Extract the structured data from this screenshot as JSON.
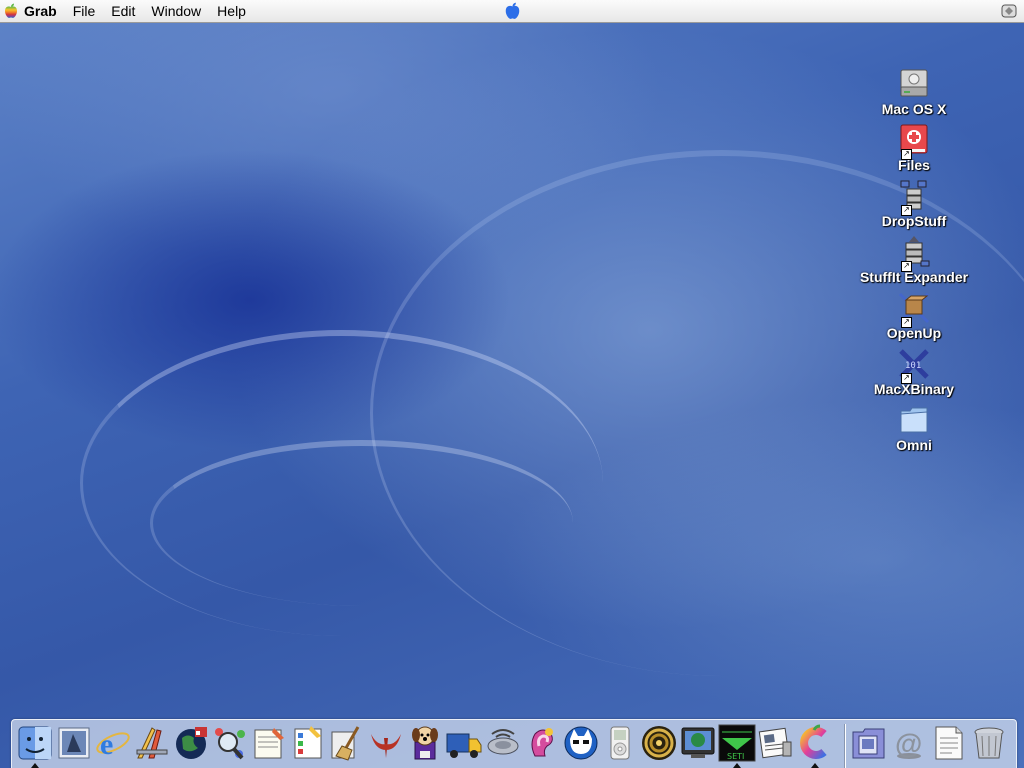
{
  "menubar": {
    "app_name": "Grab",
    "items": [
      "File",
      "Edit",
      "Window",
      "Help"
    ]
  },
  "desktop": {
    "icons": [
      {
        "label": "Mac OS X",
        "icon": "hard-drive-icon",
        "alias": false
      },
      {
        "label": "Files",
        "icon": "files-folder-icon",
        "alias": true
      },
      {
        "label": "DropStuff",
        "icon": "dropstuff-icon",
        "alias": true
      },
      {
        "label": "StuffIt Expander",
        "icon": "stuffit-expander-icon",
        "alias": true
      },
      {
        "label": "OpenUp",
        "icon": "openup-icon",
        "alias": true
      },
      {
        "label": "MacXBinary",
        "icon": "macxbinary-icon",
        "alias": true
      },
      {
        "label": "Omni",
        "icon": "folder-icon",
        "alias": false
      }
    ]
  },
  "dock": {
    "apps": [
      {
        "icon": "finder-icon",
        "running": true
      },
      {
        "icon": "mail-icon",
        "running": false
      },
      {
        "icon": "internet-explorer-icon",
        "running": false
      },
      {
        "icon": "pencil-ruler-icon",
        "running": false
      },
      {
        "icon": "globe-icon",
        "running": false
      },
      {
        "icon": "magnifier-molecule-icon",
        "running": false
      },
      {
        "icon": "notepad-icon",
        "running": false
      },
      {
        "icon": "checklist-icon",
        "running": false
      },
      {
        "icon": "broom-icon",
        "running": false
      },
      {
        "icon": "quake-icon",
        "running": false
      },
      {
        "icon": "dog-disk-icon",
        "running": false
      },
      {
        "icon": "truck-icon",
        "running": false
      },
      {
        "icon": "satellite-dish-icon",
        "running": false
      },
      {
        "icon": "ear-icon",
        "running": false
      },
      {
        "icon": "napster-icon",
        "running": false
      },
      {
        "icon": "ipod-icon",
        "running": false
      },
      {
        "icon": "spiral-icon",
        "running": false
      },
      {
        "icon": "monitor-globe-icon",
        "running": false
      },
      {
        "icon": "seti-icon",
        "running": true
      },
      {
        "icon": "newspaper-icon",
        "running": false
      },
      {
        "icon": "color-c-icon",
        "running": true
      }
    ],
    "others": [
      {
        "icon": "documents-icon"
      },
      {
        "icon": "at-sign-icon"
      },
      {
        "icon": "text-document-icon"
      },
      {
        "icon": "trash-icon"
      }
    ],
    "seti_label": "SETI"
  }
}
